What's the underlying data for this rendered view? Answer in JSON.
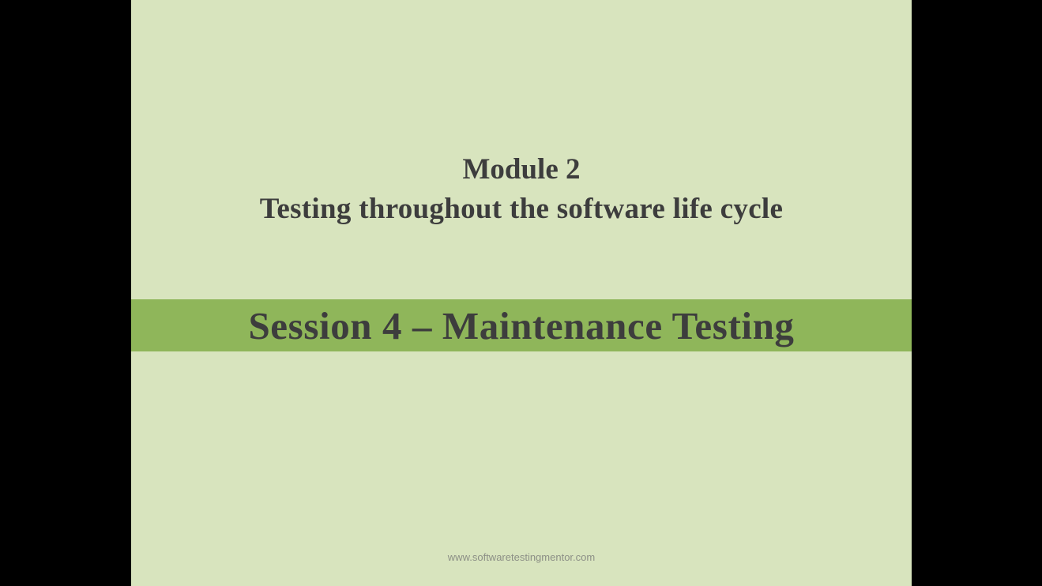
{
  "slide": {
    "module_label": "Module 2",
    "subtitle": "Testing throughout the software life cycle",
    "session_title": "Session 4 – Maintenance Testing",
    "footer_url": "www.softwaretestingmentor.com"
  },
  "colors": {
    "letterbox": "#000000",
    "slide_background": "#d8e4be",
    "session_band": "#8fb65a",
    "title_text": "#3d3d3d",
    "footer_text": "#8c8f86"
  }
}
